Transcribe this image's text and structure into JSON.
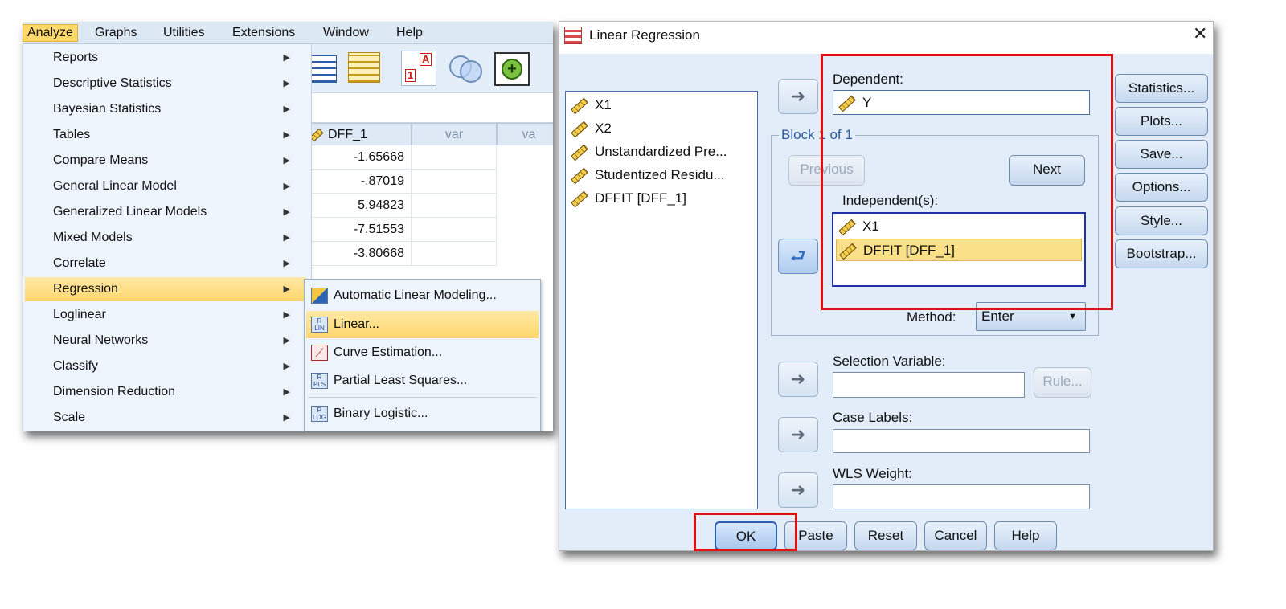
{
  "menubar": {
    "items": [
      "Analyze",
      "Graphs",
      "Utilities",
      "Extensions",
      "Window",
      "Help"
    ],
    "active": "Analyze"
  },
  "analyze_menu": {
    "items": [
      "Reports",
      "Descriptive Statistics",
      "Bayesian Statistics",
      "Tables",
      "Compare Means",
      "General Linear Model",
      "Generalized Linear Models",
      "Mixed Models",
      "Correlate",
      "Regression",
      "Loglinear",
      "Neural Networks",
      "Classify",
      "Dimension Reduction",
      "Scale"
    ],
    "selected": "Regression"
  },
  "data_editor": {
    "columns": [
      "DFF_1",
      "var",
      "va"
    ],
    "values": [
      "-1.65668",
      "-.87019",
      "5.94823",
      "-7.51553",
      "-3.80668"
    ]
  },
  "regression_submenu": {
    "items": [
      "Automatic Linear Modeling...",
      "Linear...",
      "Curve Estimation...",
      "Partial Least Squares...",
      "Binary Logistic..."
    ],
    "selected": "Linear..."
  },
  "dialog": {
    "title": "Linear Regression",
    "close_glyph": "✕",
    "source_variables": [
      "X1",
      "X2",
      "Unstandardized Pre...",
      "Studentized Residu...",
      "DFFIT [DFF_1]"
    ],
    "dependent": {
      "label": "Dependent:",
      "value": "Y"
    },
    "block_label": "Block 1 of 1",
    "previous_label": "Previous",
    "next_label": "Next",
    "independents": {
      "label": "Independent(s):",
      "items": [
        "X1",
        "DFFIT [DFF_1]"
      ],
      "selected": "DFFIT [DFF_1]"
    },
    "method": {
      "label": "Method:",
      "value": "Enter"
    },
    "selection_variable": {
      "label": "Selection Variable:",
      "value": ""
    },
    "rule_label": "Rule...",
    "case_labels": {
      "label": "Case Labels:",
      "value": ""
    },
    "wls_weight": {
      "label": "WLS Weight:",
      "value": ""
    },
    "side_buttons": [
      "Statistics...",
      "Plots...",
      "Save...",
      "Options...",
      "Style...",
      "Bootstrap..."
    ],
    "bottom_buttons": [
      "OK",
      "Paste",
      "Reset",
      "Cancel",
      "Help"
    ]
  },
  "colors": {
    "highlight": "#e01010",
    "menu_selected": "#ffd66b",
    "dialog_bg": "#e2edf9"
  }
}
